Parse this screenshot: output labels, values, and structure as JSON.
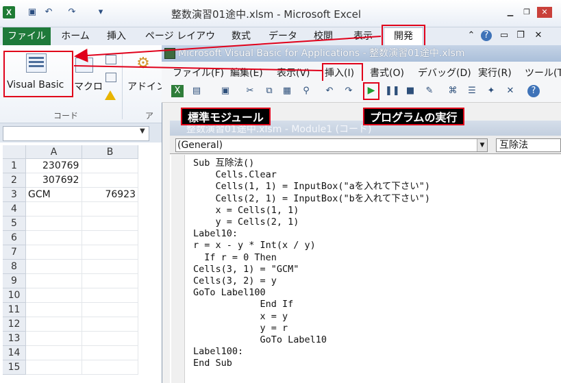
{
  "excel": {
    "title": "整数演習01途中.xlsm - Microsoft Excel",
    "tabs": [
      "ファイル",
      "ホーム",
      "挿入",
      "ページ レイアウト",
      "数式",
      "データ",
      "校閲",
      "表示",
      "開発"
    ],
    "ribbon": {
      "visual_basic": "Visual Basic",
      "macro": "マクロ",
      "addin": "アドイン",
      "group_code": "コード",
      "group_addin": "ア"
    },
    "columns": [
      "A",
      "B"
    ],
    "rows": [
      "1",
      "2",
      "3",
      "4",
      "5",
      "6",
      "7",
      "8",
      "9",
      "10",
      "11",
      "12",
      "13",
      "14",
      "15"
    ],
    "cells": [
      [
        "230769",
        ""
      ],
      [
        "307692",
        ""
      ],
      [
        "GCM",
        "76923"
      ]
    ]
  },
  "vba": {
    "title": "Microsoft Visual Basic for Applications - 整数演習01途中.xlsm",
    "menu": [
      "ファイル(F)",
      "編集(E)",
      "表示(V)",
      "挿入(I)",
      "書式(O)",
      "デバッグ(D)",
      "実行(R)",
      "ツール(T)"
    ],
    "code_window_title": "整数演習01途中.xlsm - Module1 (コード)",
    "combo_object": "(General)",
    "combo_proc": "互除法",
    "code_lines": [
      "Sub 互除法()",
      "    Cells.Clear",
      "    Cells(1, 1) = InputBox(\"aを入れて下さい\")",
      "    Cells(2, 1) = InputBox(\"bを入れて下さい\")",
      "    x = Cells(1, 1)",
      "    y = Cells(2, 1)",
      "Label10:",
      "r = x - y * Int(x / y)",
      "  If r = 0 Then",
      "Cells(3, 1) = \"GCM\"",
      "Cells(3, 2) = y",
      "GoTo Label100",
      "            End If",
      "            x = y",
      "            y = r",
      "            GoTo Label10",
      "Label100:",
      "End Sub"
    ]
  },
  "annotations": {
    "module": "標準モジュール",
    "run": "プログラムの実行"
  }
}
